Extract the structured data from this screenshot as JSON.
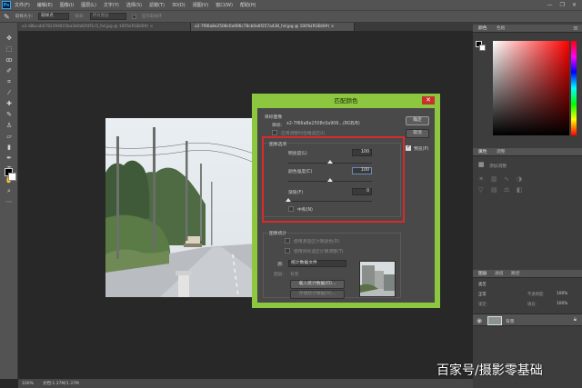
{
  "app": {
    "logo": "Ps"
  },
  "menu": [
    "文件(F)",
    "编辑(E)",
    "图像(I)",
    "图层(L)",
    "文字(Y)",
    "选择(S)",
    "滤镜(T)",
    "3D(D)",
    "视图(V)",
    "窗口(W)",
    "帮助(H)"
  ],
  "window_controls": [
    "—",
    "❐",
    "✕"
  ],
  "options_bar": {
    "sample_size_label": "取样大小:",
    "sample_size_value": "取样点",
    "sample_label": "样本:",
    "sample_value": "所有图层",
    "show_ring_label": "显示取样环"
  },
  "tabs": [
    {
      "label": "x2-d8bcab6782394815ba2bfa82f4f1c5_hd.jpg @ 100%(RGB/8#)",
      "close": "×",
      "active": false
    },
    {
      "label": "x2-7f66a8e2508c0a906c78cb0a6f257a438_hd.jpg @ 100%(RGB/8#)",
      "close": "×",
      "active": true
    }
  ],
  "status_bar": {
    "zoom": "100%",
    "doc": "文档:1.37M/1.37M"
  },
  "dialog": {
    "title": "匹配颜色",
    "close_glyph": "✕",
    "target_section": "目标图像",
    "target_label": "目标:",
    "target_value": "x2-7f66a8e2508c0a906...(RGB/8)",
    "ignore_selection": "应用调整时忽略选区(I)",
    "image_options_section": "图像选项",
    "luminance_label": "明亮度(L)",
    "luminance_value": "100",
    "luminance": 100,
    "color_intensity_label": "颜色强度(C)",
    "color_intensity_value": "100",
    "color_intensity": 100,
    "fade_label": "渐隐(F)",
    "fade_value": "0",
    "fade": 0,
    "neutralize_label": "中和(N)",
    "image_stats_section": "图像统计",
    "use_selection_source": "使用源选区计算颜色(R)",
    "use_selection_target": "使用目标选区计算调整(T)",
    "source_label": "源:",
    "source_value": "统计数据文件",
    "layer_label": "图层:",
    "layer_value": "背景",
    "load_stats_button": "载入统计数据(O)...",
    "save_stats_button": "存储统计数据(V)...",
    "ok_button": "确定",
    "cancel_button": "取消",
    "preview_label": "预览(P)",
    "preview_checked": true
  },
  "panels": {
    "color_tabs": [
      "颜色",
      "色板"
    ],
    "adjustments_tabs": [
      "属性",
      "调整"
    ],
    "adjust_title": "添加调整",
    "layers_tabs": [
      "图层",
      "通道",
      "路径"
    ],
    "layer_kind": "类型",
    "layer_mode": "正常",
    "opacity_label": "不透明度:",
    "opacity_value": "100%",
    "lock_label": "锁定:",
    "fill_label": "填充:",
    "fill_value": "100%",
    "layer_name": "背景"
  },
  "watermark": "百家号/摄影零基础"
}
